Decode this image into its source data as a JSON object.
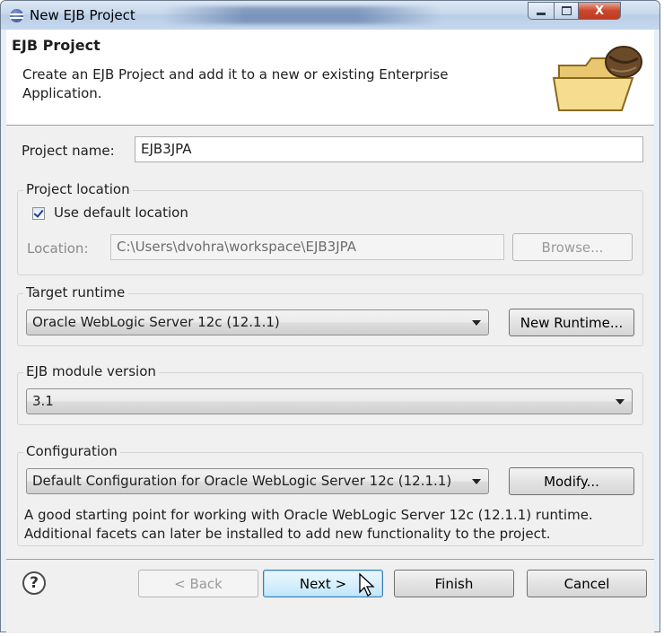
{
  "window": {
    "title": "New EJB Project"
  },
  "header": {
    "title": "EJB Project",
    "description": "Create an EJB Project and add it to a new or existing Enterprise Application."
  },
  "project_name": {
    "label": "Project name:",
    "value": "EJB3JPA"
  },
  "project_location": {
    "legend": "Project location",
    "use_default_label": "Use default location",
    "use_default_checked": true,
    "location_label": "Location:",
    "location_value": "C:\\Users\\dvohra\\workspace\\EJB3JPA",
    "browse_label": "Browse..."
  },
  "target_runtime": {
    "legend": "Target runtime",
    "selected": "Oracle WebLogic Server 12c (12.1.1)",
    "new_runtime_label": "New Runtime..."
  },
  "ejb_module_version": {
    "legend": "EJB module version",
    "selected": "3.1"
  },
  "configuration": {
    "legend": "Configuration",
    "selected": "Default Configuration for Oracle WebLogic Server 12c (12.1.1)",
    "modify_label": "Modify...",
    "description": "A good starting point for working with Oracle WebLogic Server 12c (12.1.1) runtime. Additional facets can later be installed to add new functionality to the project."
  },
  "footer": {
    "help_label": "?",
    "back_label": "< Back",
    "next_label": "Next >",
    "finish_label": "Finish",
    "cancel_label": "Cancel"
  },
  "window_buttons": {
    "close_glyph": "X"
  },
  "colors": {
    "titlebar": "#c7d8ec",
    "close": "#c9472b",
    "focus_border": "#3c7fb1"
  }
}
